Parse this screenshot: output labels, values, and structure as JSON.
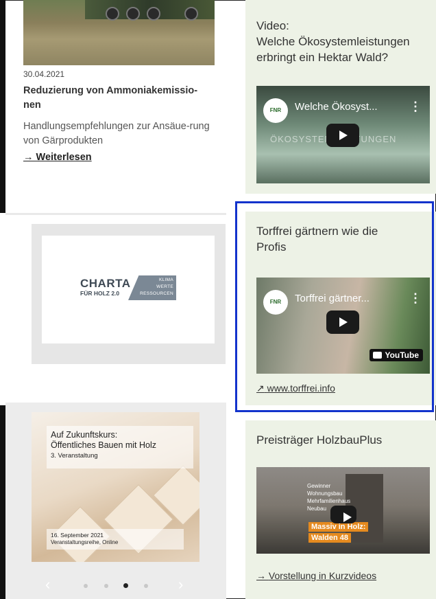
{
  "left": {
    "article": {
      "date": "30.04.2021",
      "headline": "Reduzierung von Ammoniakemissio-nen",
      "teaser": "Handlungsempfehlungen zur Ansäue-rung von Gärprodukten",
      "read_more": "→ Weiterlesen"
    },
    "charta": {
      "word": "CHARTA",
      "sub": "FÜR HOLZ 2.0",
      "tags": [
        "KLIMA",
        "WERTE",
        "RESSOURCEN"
      ]
    },
    "event": {
      "title_line1": "Auf Zukunftskurs:",
      "title_line2": "Öffentliches Bauen mit Holz",
      "subtitle": "3. Veranstaltung",
      "date": "16. September 2021",
      "info": "Veranstaltungsreihe, Online"
    },
    "carousel": {
      "prev": "‹",
      "next": "›",
      "dots": 4,
      "active": 3
    }
  },
  "right": {
    "card1": {
      "title_line1": "Video:",
      "title_line2": "Welche Ökosystemleistungen",
      "title_line3": "erbringt ein Hektar Wald?",
      "video_channel": "FNR",
      "video_title": "Welche Ökosyst...",
      "video_overlay": "ÖKOSYSTEMLEISTUNGEN"
    },
    "card2": {
      "title_line1": "Torffrei gärtnern wie die",
      "title_line2": "Profis",
      "video_channel": "FNR",
      "video_title": "Torffrei gärtner...",
      "yt_label": "YouTube",
      "link": "www.torffrei.info",
      "link_icon": "↗"
    },
    "card3": {
      "title": "Preisträger HolzbauPlus",
      "video_lines": [
        "Gewinner",
        "Wohnungsbau",
        "Mehrfamilienhaus",
        "Neubau"
      ],
      "video_highlight1": "Massiv in Holz:",
      "video_highlight2": "Walden 48",
      "link": "Vorstellung in Kurzvideos",
      "link_icon": "→"
    }
  },
  "colors": {
    "accent_blue": "#1233cc",
    "card_bg": "#edf2e6",
    "highlight_orange": "#e58a1f"
  }
}
